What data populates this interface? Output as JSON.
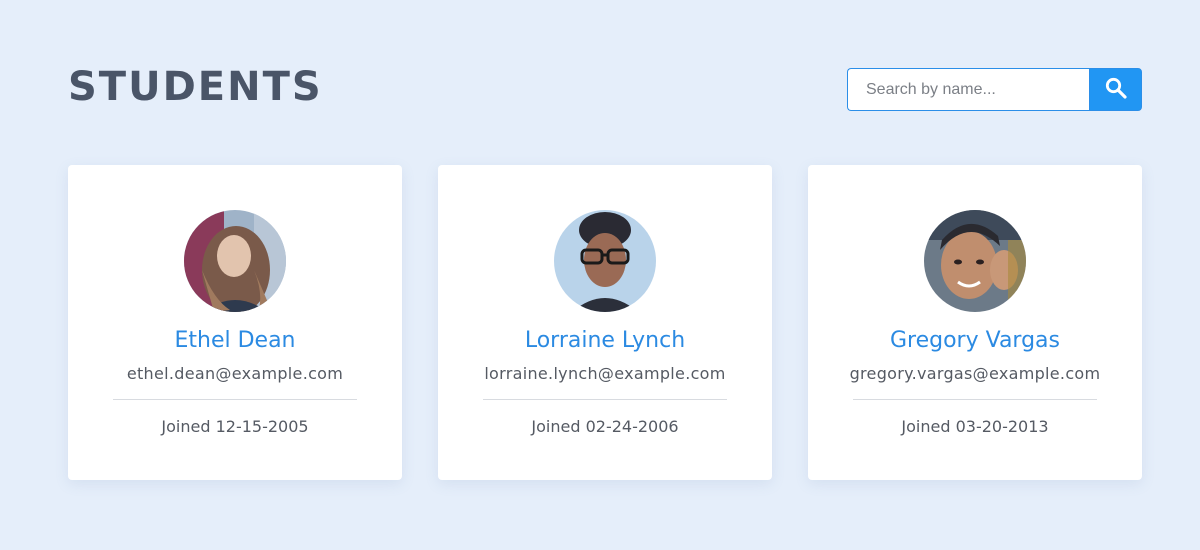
{
  "header": {
    "title": "STUDENTS"
  },
  "search": {
    "placeholder": "Search by name...",
    "value": "",
    "button_icon": "search-icon"
  },
  "colors": {
    "background": "#e5eefa",
    "accent": "#2196f3",
    "name_text": "#2b8ae2",
    "title_text": "#4a5568"
  },
  "students": [
    {
      "name": "Ethel Dean",
      "email": "ethel.dean@example.com",
      "joined": "Joined 12-15-2005"
    },
    {
      "name": "Lorraine Lynch",
      "email": "lorraine.lynch@example.com",
      "joined": "Joined 02-24-2006"
    },
    {
      "name": "Gregory Vargas",
      "email": "gregory.vargas@example.com",
      "joined": "Joined 03-20-2013"
    }
  ]
}
